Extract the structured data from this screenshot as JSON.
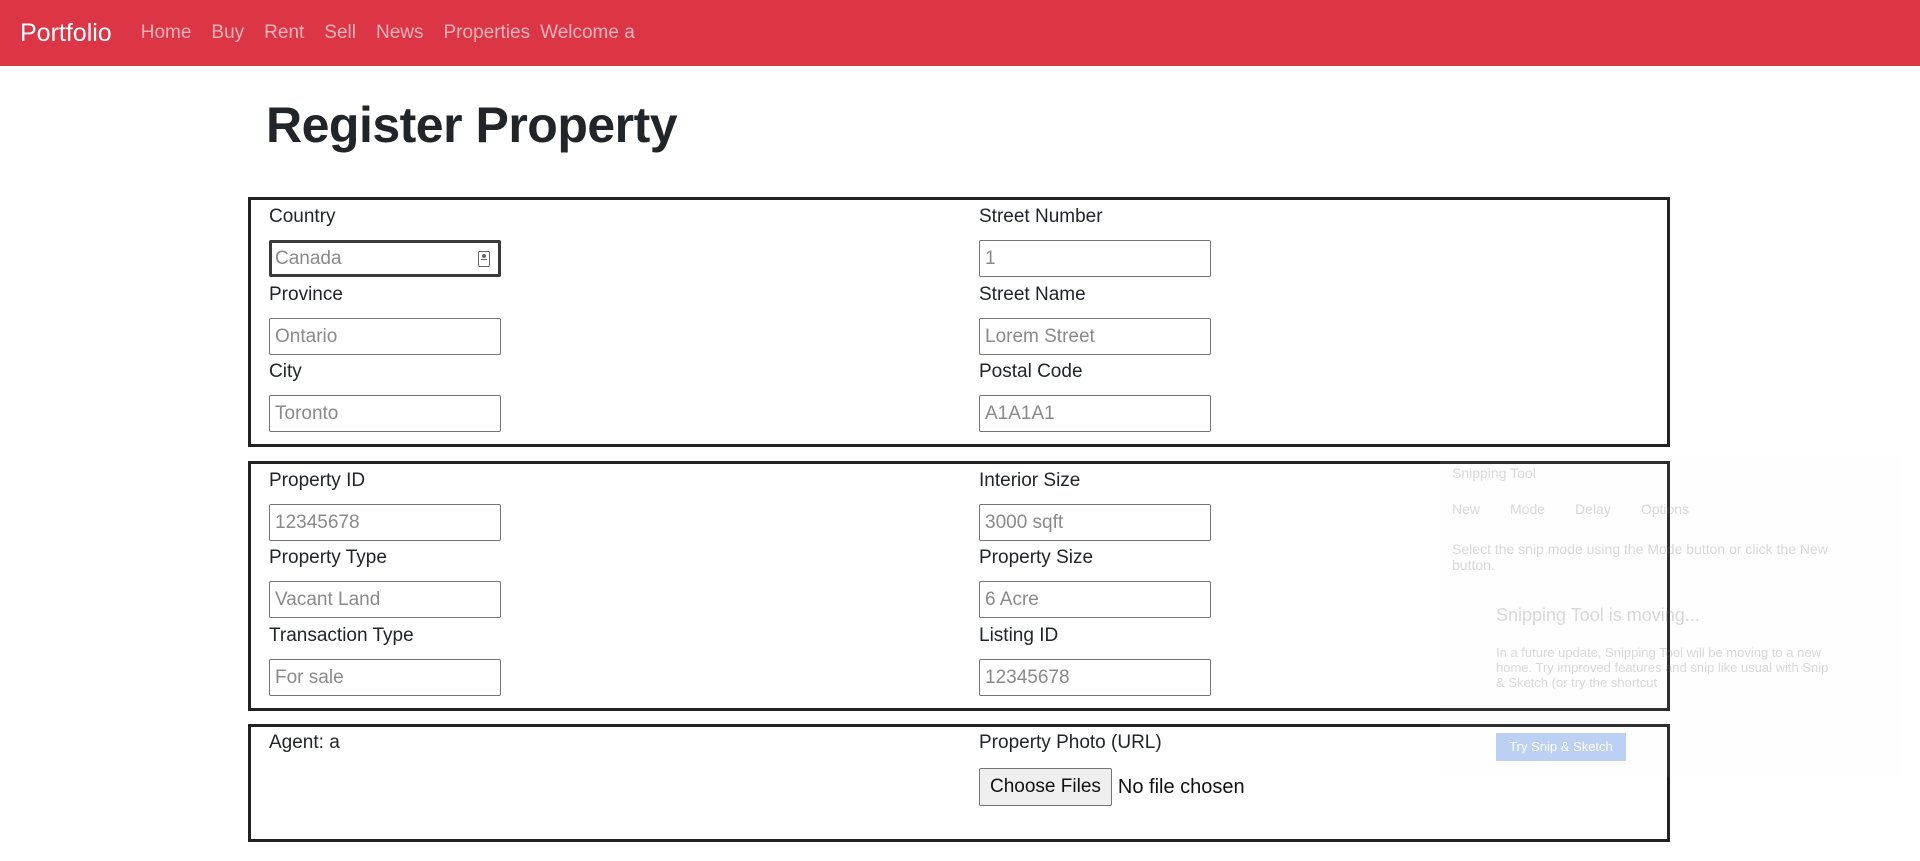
{
  "navbar": {
    "brand": "Portfolio",
    "links": [
      "Home",
      "Buy",
      "Rent",
      "Sell",
      "News",
      "Properties"
    ],
    "welcome": "Welcome a"
  },
  "page_title": "Register Property",
  "address": {
    "country": {
      "label": "Country",
      "placeholder": "Canada"
    },
    "province": {
      "label": "Province",
      "placeholder": "Ontario"
    },
    "city": {
      "label": "City",
      "placeholder": "Toronto"
    },
    "street_number": {
      "label": "Street Number",
      "placeholder": "1"
    },
    "street_name": {
      "label": "Street Name",
      "placeholder": "Lorem Street"
    },
    "postal_code": {
      "label": "Postal Code",
      "placeholder": "A1A1A1"
    }
  },
  "property": {
    "property_id": {
      "label": "Property ID",
      "placeholder": "12345678"
    },
    "property_type": {
      "label": "Property Type",
      "placeholder": "Vacant Land"
    },
    "transaction_type": {
      "label": "Transaction Type",
      "placeholder": "For sale"
    },
    "interior_size": {
      "label": "Interior Size",
      "placeholder": "3000 sqft"
    },
    "property_size": {
      "label": "Property Size",
      "placeholder": "6 Acre"
    },
    "listing_id": {
      "label": "Listing ID",
      "placeholder": "12345678"
    }
  },
  "extra": {
    "agent": "Agent: a",
    "photo_label": "Property Photo (URL)",
    "file_button": "Choose Files",
    "file_status": "No file chosen"
  },
  "snipping_tool": {
    "title": "Snipping Tool",
    "toolbar": [
      "New",
      "Mode",
      "Delay",
      "Options"
    ],
    "hint": "Select the snip mode using the Mode button or click the New button.",
    "heading": "Snipping Tool is moving...",
    "body": "In a future update, Snipping Tool will be moving to a new home. Try improved features and snip like usual with Snip & Sketch (or try the shortcut",
    "cta": "Try Snip & Sketch"
  },
  "colors": {
    "navbar": "#dc3545",
    "panel_border": "#222222"
  }
}
